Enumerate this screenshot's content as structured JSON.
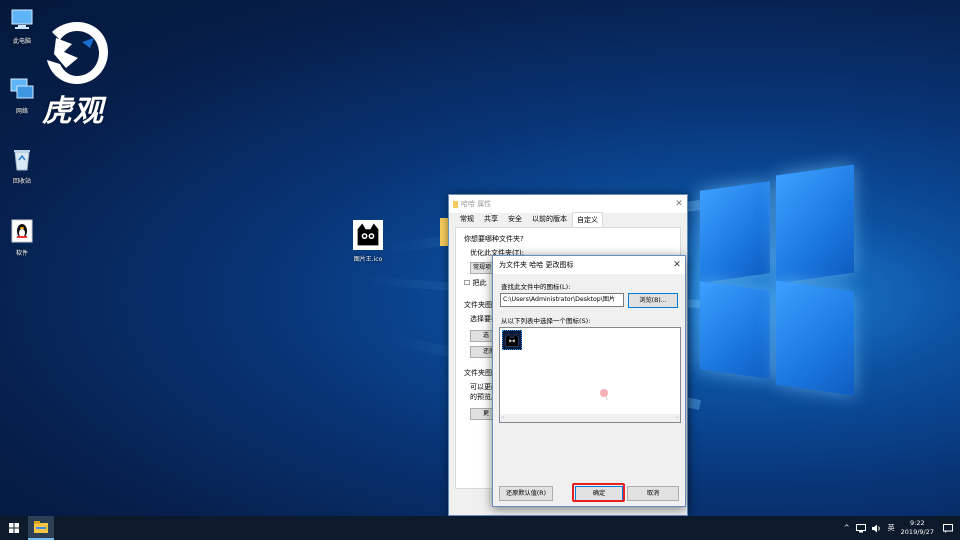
{
  "desktop": {
    "brand_text": "虎观",
    "icons": [
      {
        "label": "此电脑",
        "icon": "computer-icon"
      },
      {
        "label": "网络",
        "icon": "network-icon"
      },
      {
        "label": "回收站",
        "icon": "recycle-bin-icon"
      },
      {
        "label": "软件",
        "icon": "qq-penguin-icon"
      },
      {
        "label": "图片王.ico",
        "icon": "cat-ico-file-icon"
      }
    ]
  },
  "props_window": {
    "title": "哈哈 属性",
    "tabs": [
      "常规",
      "共享",
      "安全",
      "以前的版本",
      "自定义"
    ],
    "active_tab": "自定义",
    "lines": [
      "你想要哪种文件夹?",
      "优化此文件夹(T):",
      "常规项",
      "把此",
      "文件夹图",
      "选择要在",
      "选",
      "还原",
      "文件夹图",
      "可以更改",
      "的预览。",
      "更"
    ]
  },
  "dialog": {
    "title": "为文件夹 哈哈 更改图标",
    "find_label": "查找此文件中的图标(L):",
    "path_value": "C:\\Users\\Administrator\\Desktop\\图片",
    "browse_label": "浏览(B)...",
    "list_label": "从以下列表中选择一个图标(S):",
    "restore_label": "还原默认值(R)",
    "ok_label": "确定",
    "cancel_label": "取消",
    "scroll_left": "‹",
    "scroll_right": "›"
  },
  "taskbar": {
    "time": "9:22",
    "date": "2019/9/27",
    "ime": "英",
    "tray_chevron": "^"
  },
  "colors": {
    "highlight": "#e62020",
    "accent": "#0078d7",
    "taskbar": "#0d1a2b"
  }
}
